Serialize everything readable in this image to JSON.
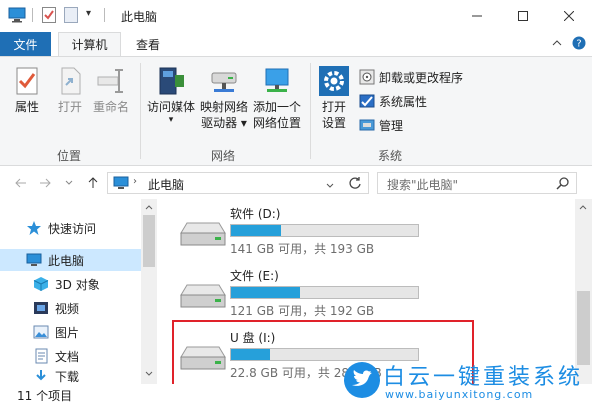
{
  "window": {
    "title": "此电脑",
    "qat_dropdown": "▾"
  },
  "tabs": {
    "file": "文件",
    "computer": "计算机",
    "view": "查看"
  },
  "ribbon": {
    "location": {
      "label": "位置",
      "properties": "属性",
      "open": "打开",
      "rename": "重命名"
    },
    "network": {
      "label": "网络",
      "access_media": "访问媒体",
      "map_drive_1": "映射网络",
      "map_drive_2": "驱动器",
      "add_location_1": "添加一个",
      "add_location_2": "网络位置"
    },
    "system": {
      "label": "系统",
      "open_settings_1": "打开",
      "open_settings_2": "设置",
      "uninstall": "卸载或更改程序",
      "system_properties": "系统属性",
      "manage": "管理"
    }
  },
  "address": {
    "path": "此电脑",
    "search_placeholder": "搜索\"此电脑\""
  },
  "navpane": {
    "items": [
      {
        "label": "快速访问"
      },
      {
        "label": "此电脑"
      },
      {
        "label": "3D 对象"
      },
      {
        "label": "视频"
      },
      {
        "label": "图片"
      },
      {
        "label": "文档"
      },
      {
        "label": "下载"
      }
    ]
  },
  "drives": [
    {
      "name": "软件 (D:)",
      "info": "141 GB 可用，共 193 GB",
      "used_fraction": 0.27
    },
    {
      "name": "文件 (E:)",
      "info": "121 GB 可用，共 192 GB",
      "used_fraction": 0.37
    },
    {
      "name": "U 盘 (I:)",
      "info": "22.8 GB 可用，共 28.8 GB",
      "used_fraction": 0.21
    }
  ],
  "status": {
    "item_count": "11 个项目"
  },
  "watermark": {
    "text": "白云一键重装系统",
    "url": "www.baiyunxitong.com"
  },
  "colors": {
    "accent": "#1f6fb5",
    "drive_fill": "#26a0da",
    "highlight": "#e0222a",
    "selected": "#cce8ff"
  }
}
